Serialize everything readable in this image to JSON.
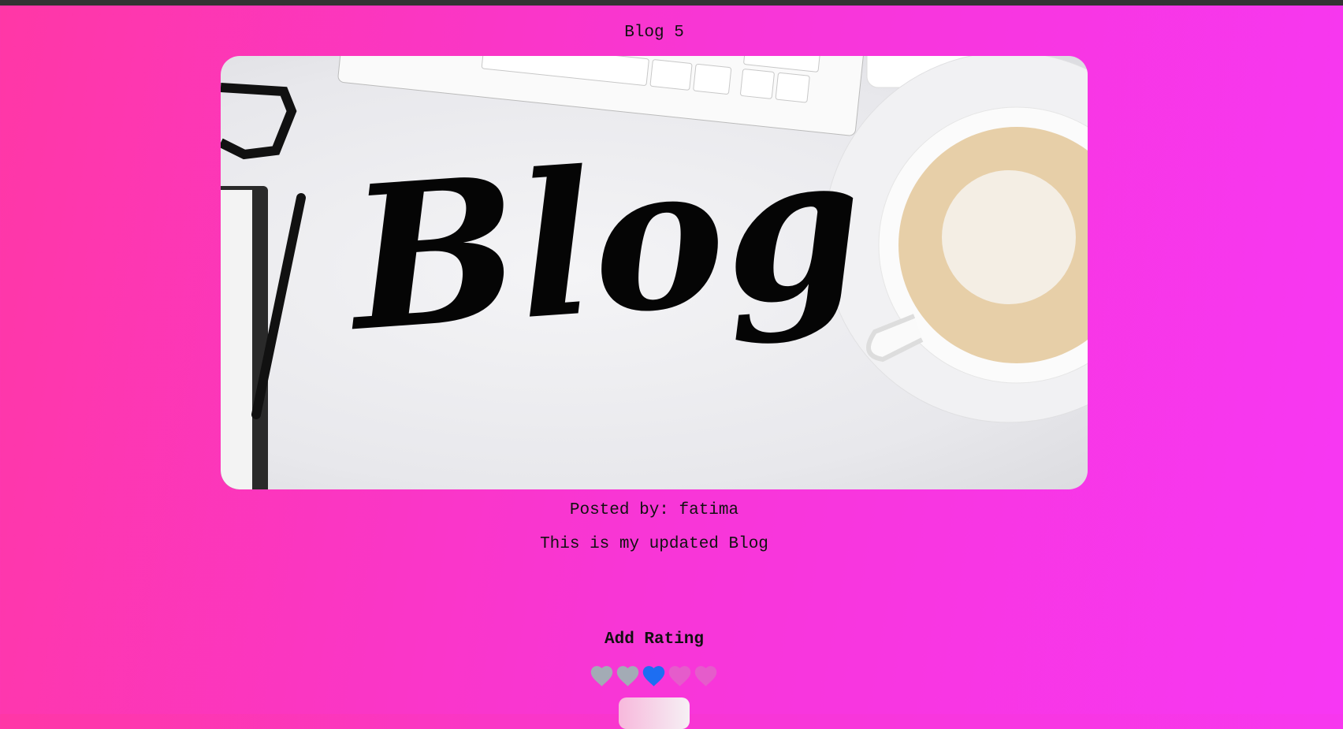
{
  "post": {
    "title": "Blog 5",
    "image_alt": "Blog",
    "posted_by": "Posted by: fatima",
    "description": "This is my updated Blog"
  },
  "rating": {
    "title": "Add Rating",
    "value": 3,
    "max": 5,
    "colors": {
      "filled_past": "#a3abb5",
      "selected": "#1d6ef2",
      "empty": "#e55ccb"
    }
  },
  "submit_label": ""
}
